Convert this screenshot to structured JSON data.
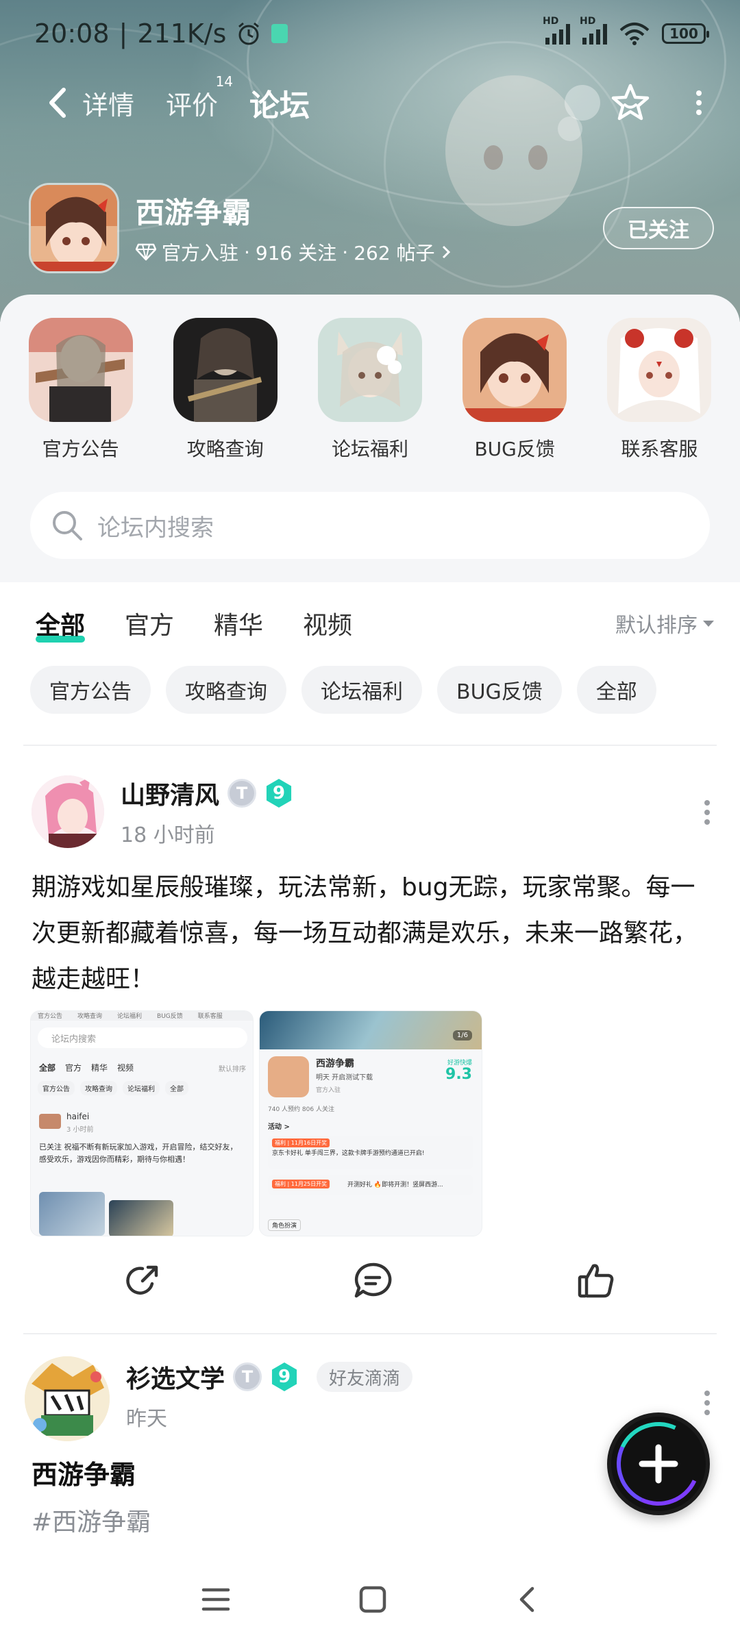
{
  "status_bar": {
    "time": "20:08",
    "separator": "|",
    "speed": "211K/s",
    "network1": "HD",
    "network2": "HD",
    "battery": "100"
  },
  "nav": {
    "tabs": [
      {
        "label": "详情"
      },
      {
        "label": "评价",
        "badge": "14"
      },
      {
        "label": "论坛"
      }
    ],
    "active_tab": "论坛"
  },
  "game": {
    "name": "西游争霸",
    "official": "官方入驻",
    "followers": "916 关注",
    "posts": "262 帖子",
    "dot": "·",
    "follow_button": "已关注"
  },
  "categories": [
    {
      "label": "官方公告"
    },
    {
      "label": "攻略查询"
    },
    {
      "label": "论坛福利"
    },
    {
      "label": "BUG反馈"
    },
    {
      "label": "联系客服"
    }
  ],
  "search": {
    "placeholder": "论坛内搜索"
  },
  "filter_tabs": [
    {
      "label": "全部"
    },
    {
      "label": "官方"
    },
    {
      "label": "精华"
    },
    {
      "label": "视频"
    }
  ],
  "sort_label": "默认排序",
  "chips": [
    {
      "label": "官方公告"
    },
    {
      "label": "攻略查询"
    },
    {
      "label": "论坛福利"
    },
    {
      "label": "BUG反馈"
    },
    {
      "label": "全部"
    }
  ],
  "post1": {
    "author": "山野清风",
    "badge_t": "T",
    "badge_level": "9",
    "time": "18 小时前",
    "content": "期游戏如星辰般璀璨，玩法常新，bug无踪，玩家常聚。每一次更新都藏着惊喜，每一场互动都满是欢乐，未来一路繁花，越走越旺！",
    "image1": {
      "tabs": [
        "官方公告",
        "攻略查询",
        "论坛福利",
        "BUG反馈",
        "联系客服"
      ],
      "search": "论坛内搜索",
      "filter": [
        "全部",
        "官方",
        "精华",
        "视频"
      ],
      "sort": "默认排序",
      "chips": [
        "官方公告",
        "攻略查询",
        "论坛福利",
        "全部"
      ],
      "user": "haifei",
      "time": "3 小时前",
      "text": "已关注 祝福不断有新玩家加入游戏，开启冒险，结交好友，感受欢乐，游戏因你而精彩，期待与你相遇！"
    },
    "image2": {
      "counter": "1/6",
      "game": "西游争霸",
      "sub": "明天 开启测试下载",
      "score_label": "好游快爆",
      "score": "9.3",
      "official": "官方入驻",
      "stats": "740 人预约   806 人关注",
      "activity": "活动 >",
      "event1_tag": "福利 | 11月16日开奖",
      "event1": "京东卡好礼 单手闯三界，这款卡牌手游预约通道已开启!",
      "event2_tag": "福利 | 11月25日开奖",
      "event2": "开测好礼 🔥即将开测！竖屏西游...",
      "footer": "角色扮演"
    }
  },
  "post2": {
    "author": "衫选文学",
    "badge_t": "T",
    "badge_level": "9",
    "friend_tag": "好友滴滴",
    "time": "昨天",
    "title": "西游争霸",
    "tag": "#西游争霸"
  },
  "colors": {
    "accent": "#1fd1b0",
    "hero_bg": "#7c9b9b"
  }
}
